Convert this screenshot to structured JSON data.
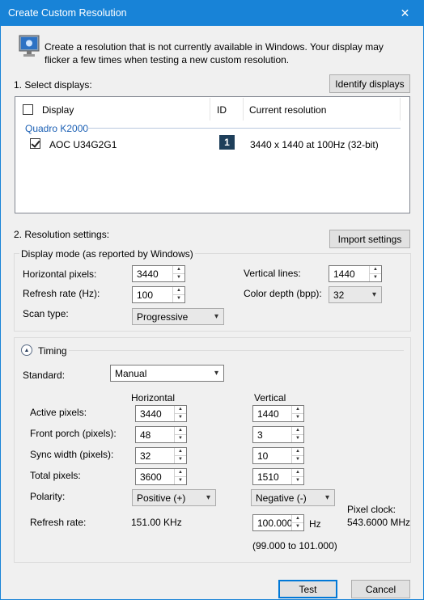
{
  "window": {
    "title": "Create Custom Resolution",
    "close_glyph": "✕"
  },
  "intro": {
    "text": "Create a resolution that is not currently available in Windows. Your display may flicker a few times when testing a new custom resolution."
  },
  "select_displays": {
    "label": "1. Select displays:",
    "identify_button": "Identify displays",
    "columns": {
      "display": "Display",
      "id": "ID",
      "current_resolution": "Current resolution"
    },
    "gpu": "Quadro K2000",
    "rows": [
      {
        "display": "AOC U34G2G1",
        "id": "1",
        "resolution": "3440 x 1440 at 100Hz (32-bit)",
        "checked": true
      }
    ]
  },
  "resolution_settings": {
    "label": "2. Resolution settings:",
    "import_button": "Import settings",
    "display_mode": {
      "legend": "Display mode (as reported by Windows)",
      "horizontal_pixels_label": "Horizontal pixels:",
      "horizontal_pixels": "3440",
      "vertical_lines_label": "Vertical lines:",
      "vertical_lines": "1440",
      "refresh_rate_label": "Refresh rate (Hz):",
      "refresh_rate": "100",
      "color_depth_label": "Color depth (bpp):",
      "color_depth": "32",
      "scan_type_label": "Scan type:",
      "scan_type": "Progressive"
    },
    "timing": {
      "legend": "Timing",
      "standard_label": "Standard:",
      "standard": "Manual",
      "horizontal_header": "Horizontal",
      "vertical_header": "Vertical",
      "active_pixels_label": "Active pixels:",
      "active_h": "3440",
      "active_v": "1440",
      "front_porch_label": "Front porch (pixels):",
      "front_porch_h": "48",
      "front_porch_v": "3",
      "sync_width_label": "Sync width (pixels):",
      "sync_width_h": "32",
      "sync_width_v": "10",
      "total_pixels_label": "Total pixels:",
      "total_h": "3600",
      "total_v": "1510",
      "polarity_label": "Polarity:",
      "polarity_h": "Positive (+)",
      "polarity_v": "Negative (-)",
      "refresh_rate_label": "Refresh rate:",
      "refresh_h": "151.00 KHz",
      "refresh_v": "100.000",
      "refresh_unit": "Hz",
      "refresh_range": "(99.000 to 101.000)",
      "pixel_clock_label": "Pixel clock:",
      "pixel_clock": "543.6000 MHz"
    }
  },
  "footer": {
    "test_button": "Test",
    "cancel_button": "Cancel"
  }
}
